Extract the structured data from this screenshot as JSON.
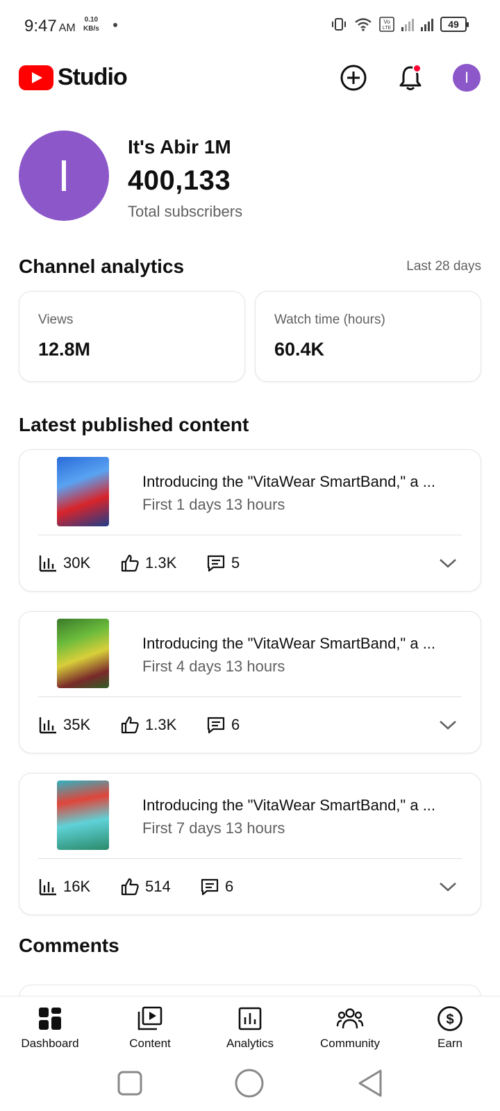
{
  "status_bar": {
    "time": "9:47",
    "ampm": "AM",
    "speed_value": "0.10",
    "speed_unit": "KB/s",
    "volte": "Vo LTE",
    "battery": "49"
  },
  "header": {
    "app_name": "Studio",
    "avatar_initial": "I"
  },
  "channel": {
    "avatar_initial": "I",
    "name": "It's Abir 1M",
    "subscribers": "400,133",
    "subscribers_label": "Total subscribers"
  },
  "analytics": {
    "title": "Channel analytics",
    "period": "Last 28 days",
    "views_label": "Views",
    "views_value": "12.8M",
    "watch_label": "Watch time (hours)",
    "watch_value": "60.4K"
  },
  "latest": {
    "title": "Latest published content",
    "videos": [
      {
        "title": "Introducing the \"VitaWear SmartBand,\" a ...",
        "subtitle": "First 1 days 13 hours",
        "views": "30K",
        "likes": "1.3K",
        "comments": "5"
      },
      {
        "title": "Introducing the \"VitaWear SmartBand,\" a ...",
        "subtitle": "First 4 days 13 hours",
        "views": "35K",
        "likes": "1.3K",
        "comments": "6"
      },
      {
        "title": "Introducing the \"VitaWear SmartBand,\" a ...",
        "subtitle": "First 7 days 13 hours",
        "views": "16K",
        "likes": "514",
        "comments": "6"
      }
    ]
  },
  "comments": {
    "title": "Comments"
  },
  "nav": {
    "items": [
      {
        "label": "Dashboard",
        "icon": "dashboard-icon"
      },
      {
        "label": "Content",
        "icon": "content-icon"
      },
      {
        "label": "Analytics",
        "icon": "analytics-icon"
      },
      {
        "label": "Community",
        "icon": "community-icon"
      },
      {
        "label": "Earn",
        "icon": "earn-icon"
      }
    ]
  },
  "colors": {
    "brand_red": "#ff0000",
    "avatar_purple": "#8c57c9",
    "secondary_text": "#606060"
  }
}
